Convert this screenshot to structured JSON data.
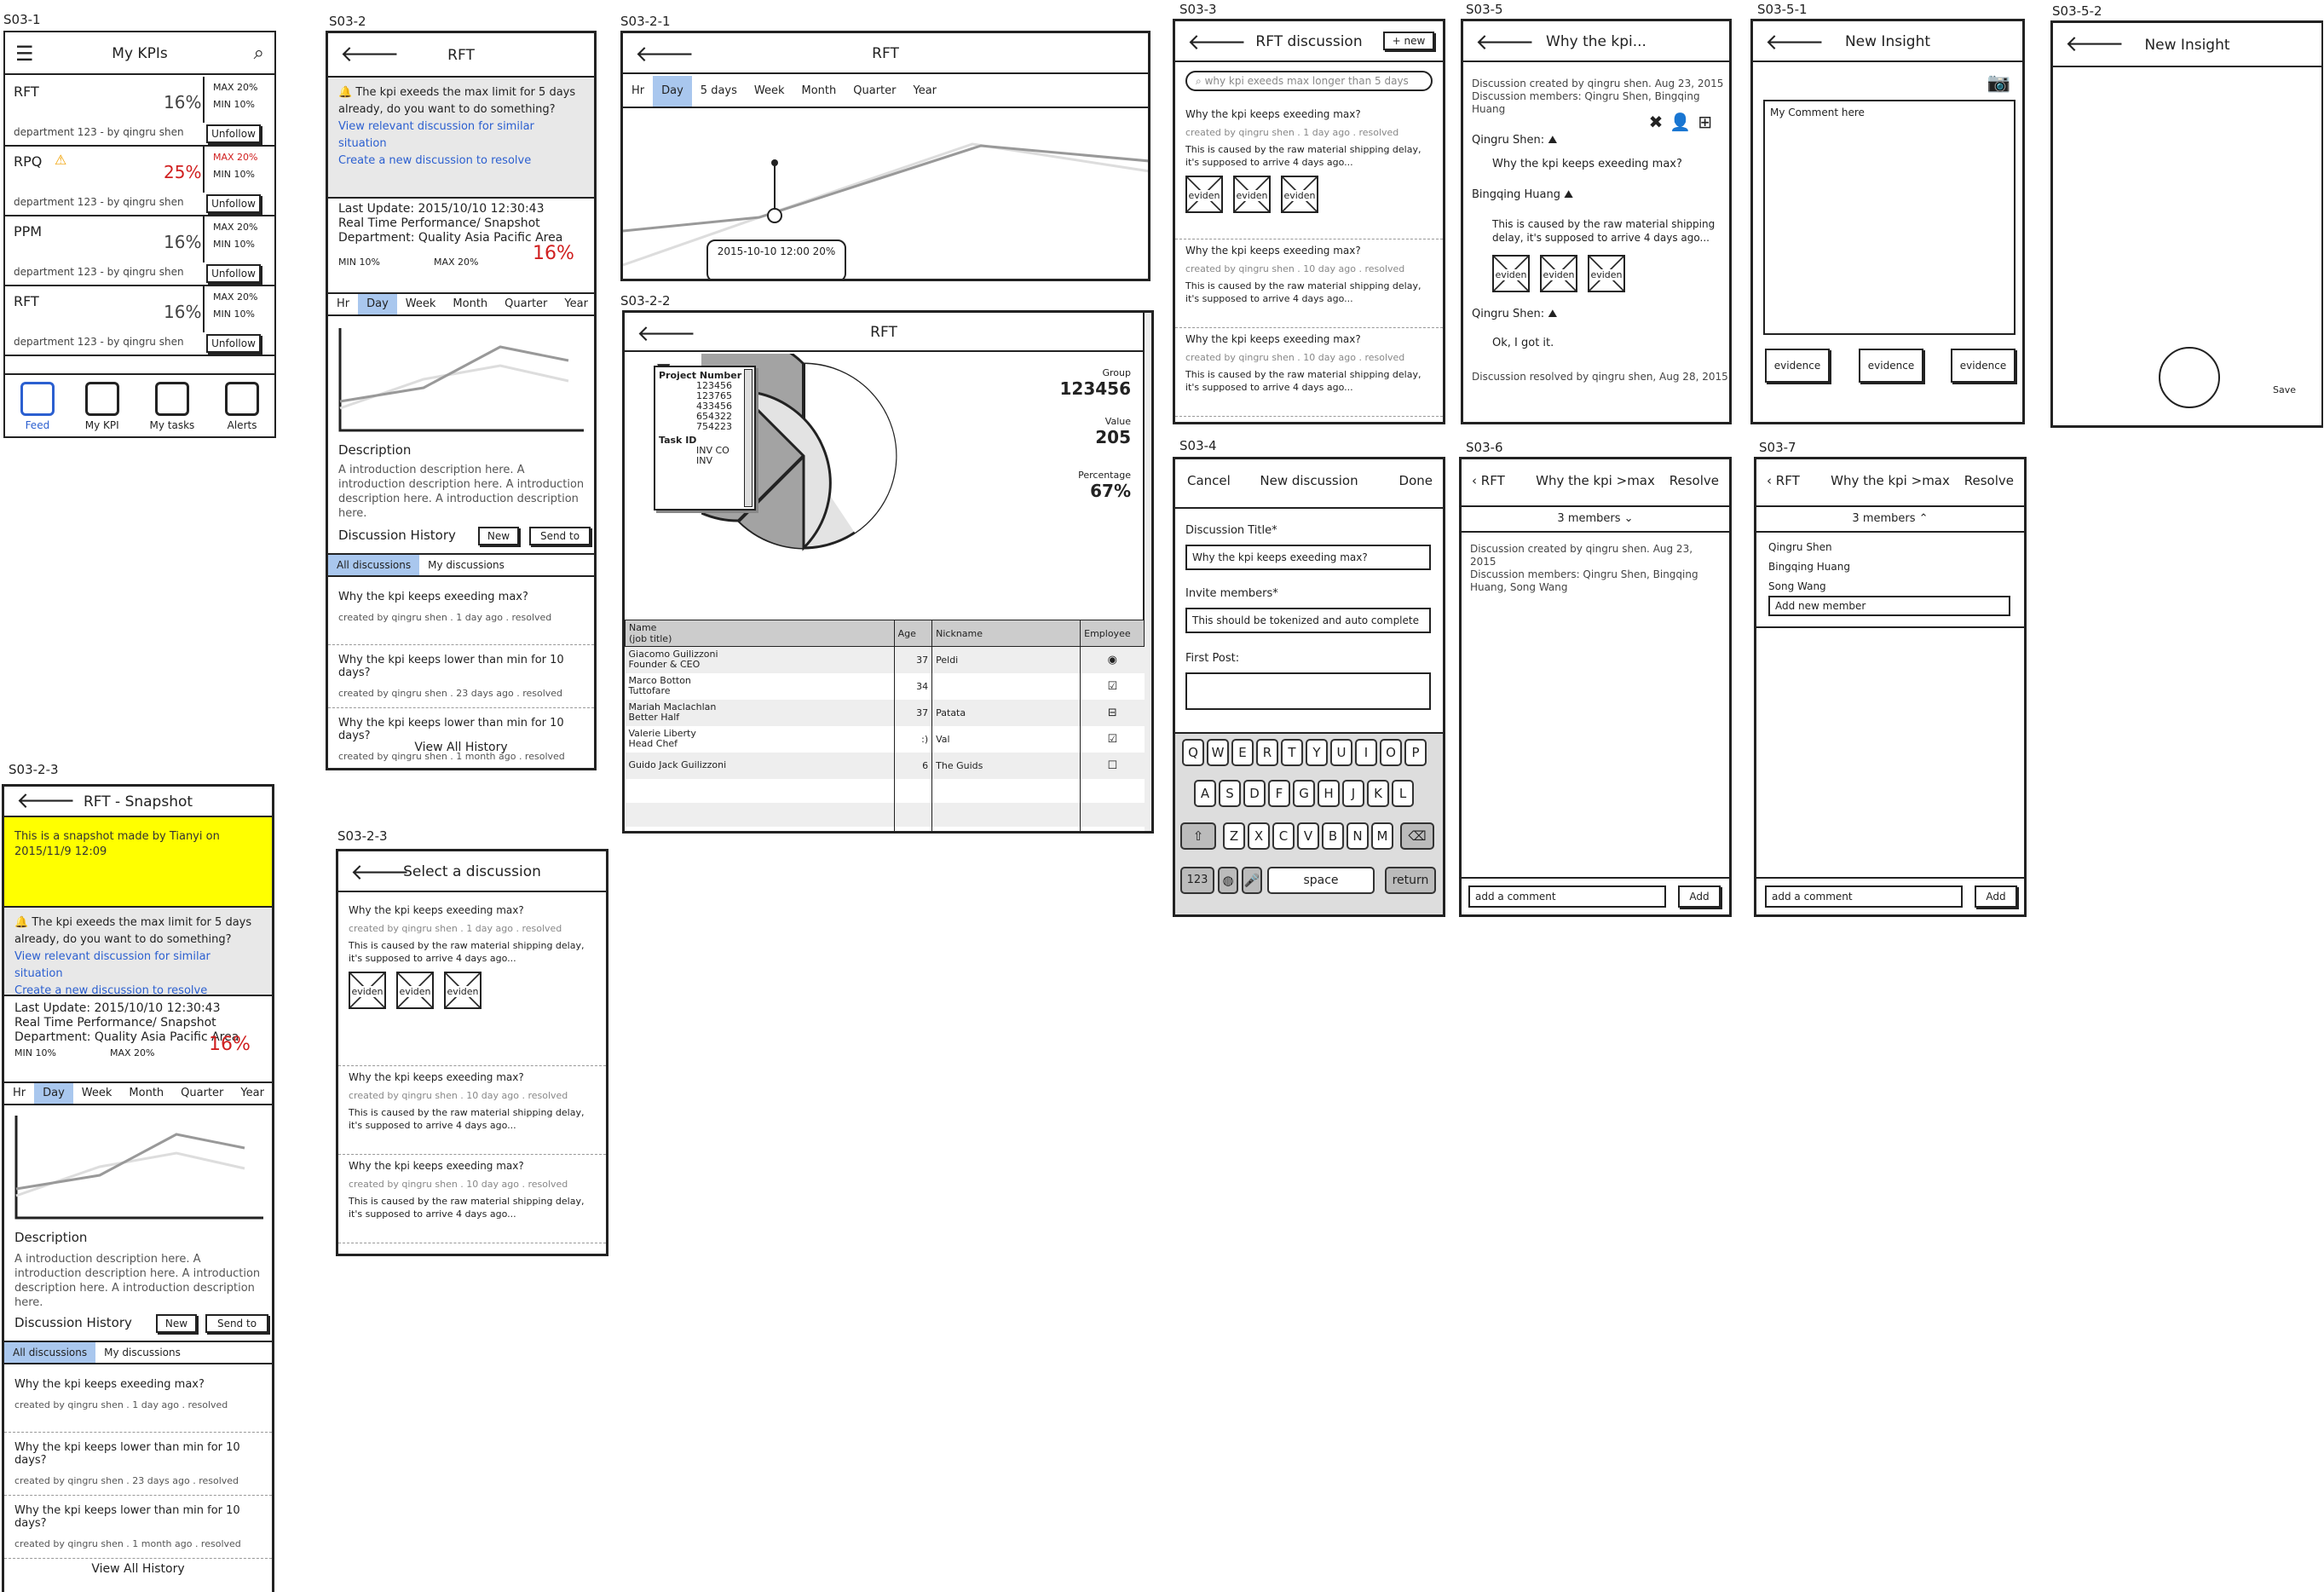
{
  "labels": {
    "s1": "S03-1",
    "s2": "S03-2",
    "s21": "S03-2-1",
    "s22": "S03-2-2",
    "s23a": "S03-2-3",
    "s23b": "S03-2-3",
    "s3": "S03-3",
    "s4": "S03-4",
    "s5": "S03-5",
    "s51": "S03-5-1",
    "s52": "S03-5-2",
    "s6": "S03-6",
    "s7": "S03-7"
  },
  "s1": {
    "title": "My KPIs",
    "kpis": [
      {
        "name": "RFT",
        "val": "16%",
        "max": "MAX 20%",
        "min": "MIN 10%",
        "dept": "department 123 - by qingru shen",
        "btn": "Unfollow",
        "alert": false
      },
      {
        "name": "RPQ",
        "val": "25%",
        "max": "MAX 20%",
        "min": "MIN 10%",
        "dept": "department 123 - by qingru shen",
        "btn": "Unfollow",
        "alert": true
      },
      {
        "name": "PPM",
        "val": "16%",
        "max": "MAX 20%",
        "min": "MIN 10%",
        "dept": "department 123 - by qingru shen",
        "btn": "Unfollow",
        "alert": false
      },
      {
        "name": "RFT",
        "val": "16%",
        "max": "MAX 20%",
        "min": "MIN 10%",
        "dept": "department 123 - by qingru shen",
        "btn": "Unfollow",
        "alert": false
      }
    ],
    "nav": [
      "Feed",
      "My KPI",
      "My tasks",
      "Alerts"
    ]
  },
  "s2": {
    "title": "RFT",
    "alert": "The kpi exeeds the max limit for 5 days already, do you want to do something?",
    "link1": "View relevant discussion for similar situation",
    "link2": "Create a new discussion to resolve",
    "update": "Last Update: 2015/10/10 12:30:43",
    "perf": "Real Time Performance/ Snapshot",
    "dept": "Department: Quality Asia Pacific Area",
    "min": "MIN 10%",
    "max": "MAX 20%",
    "val": "16%",
    "tabs": [
      "Hr",
      "Day",
      "Week",
      "Month",
      "Quarter",
      "Year"
    ],
    "desc_h": "Description",
    "desc": "A introduction description here. A introduction description here. A introduction description here. A introduction description here.",
    "hist": "Discussion History",
    "new": "New",
    "send": "Send to",
    "dtabs": [
      "All discussions",
      "My discussions"
    ],
    "items": [
      {
        "t": "Why the kpi keeps exeeding max?",
        "m": "created by qingru shen . 1 day ago . resolved"
      },
      {
        "t": "Why the kpi keeps lower than min for 10 days?",
        "m": "created by qingru shen . 23 days ago . resolved"
      },
      {
        "t": "Why the kpi keeps lower than min for 10 days?",
        "m": "created by qingru shen . 1 month ago . resolved"
      }
    ],
    "all": "View All History"
  },
  "s21": {
    "title": "RFT",
    "tabs": [
      "Hr",
      "Day",
      "5 days",
      "Week",
      "Month",
      "Quarter",
      "Year"
    ],
    "tip": "2015-10-10 12:00 20%"
  },
  "s22": {
    "title": "RFT",
    "filter": {
      "h1": "Project Number",
      "nums": [
        "123456",
        "123765",
        "433456",
        "654322",
        "754223"
      ],
      "h2": "Task ID",
      "ids": [
        "INV CO",
        "INV"
      ]
    },
    "group_l": "Group",
    "group_v": "123456",
    "value_l": "Value",
    "value_v": "205",
    "pct_l": "Percentage",
    "pct_v": "67%",
    "cols": [
      "Name\n(job title)",
      "Age",
      "Nickname",
      "Employee"
    ],
    "rows": [
      {
        "n": "Giacomo Guilizzoni\nFounder & CEO",
        "a": "37",
        "k": "Peldi",
        "e": "radio"
      },
      {
        "n": "Marco Botton\nTuttofare",
        "a": "34",
        "k": "",
        "e": "check"
      },
      {
        "n": "Mariah Maclachlan\nBetter Half",
        "a": "37",
        "k": "Patata",
        "e": "minus"
      },
      {
        "n": "Valerie Liberty\nHead Chef",
        "a": ":)",
        "k": "Val",
        "e": "check"
      },
      {
        "n": "Guido Jack Guilizzoni",
        "a": "6",
        "k": "The Guids",
        "e": "empty"
      }
    ]
  },
  "s23": {
    "title": "RFT - Snapshot",
    "note": "This is a snapshot made by Tianyi on 2015/11/9 12:09"
  },
  "s23b": {
    "title": "Select a discussion",
    "items": [
      {
        "t": "Why the kpi keeps exeeding max?",
        "m": "created by qingru shen . 1 day ago . resolved",
        "b": "This is caused by the raw material shipping delay, it's supposed to arrive 4 days ago...",
        "ev": true
      },
      {
        "t": "Why the kpi keeps exeeding max?",
        "m": "created by qingru shen . 10 day ago . resolved",
        "b": "This is caused by the raw material shipping delay, it's supposed to arrive 4 days ago...",
        "ev": false
      },
      {
        "t": "Why the kpi keeps exeeding max?",
        "m": "created by qingru shen . 10 day ago . resolved",
        "b": "This is caused by the raw material shipping delay, it's supposed to arrive 4 days ago...",
        "ev": false
      }
    ],
    "ev": "eviden"
  },
  "s3": {
    "title": "RFT discussion",
    "new": "+ new",
    "search": "why kpi exeeds max longer than 5 days"
  },
  "s4": {
    "cancel": "Cancel",
    "title": "New discussion",
    "done": "Done",
    "l1": "Discussion Title*",
    "v1": "Why the kpi keeps exeeding max?",
    "l2": "Invite members*",
    "v2": "This should be tokenized and auto complete",
    "l3": "First Post:",
    "row1": [
      "Q",
      "W",
      "E",
      "R",
      "T",
      "Y",
      "U",
      "I",
      "O",
      "P"
    ],
    "row2": [
      "A",
      "S",
      "D",
      "F",
      "G",
      "H",
      "J",
      "K",
      "L"
    ],
    "row3": [
      "Z",
      "X",
      "C",
      "V",
      "B",
      "N",
      "M"
    ],
    "k123": "123",
    "space": "space",
    "ret": "return"
  },
  "s5": {
    "title": "Why the kpi...",
    "created": "Discussion created by qingru shen. Aug 23, 2015",
    "members": "Discussion members: Qingru Shen, Bingqing Huang",
    "u1": "Qingru Shen:",
    "m1": "Why the kpi keeps exeeding max?",
    "u2": "Bingqing Huang",
    "m2": "This is caused by the raw material shipping delay, it's supposed to arrive 4 days ago...",
    "u3": "Qingru Shen:",
    "m3": "Ok, I got it.",
    "resolved": "Discussion resolved by qingru shen, Aug 28, 2015"
  },
  "s51": {
    "title": "New Insight",
    "comment": "My Comment here",
    "ev": "evidence"
  },
  "s52": {
    "title": "New Insight",
    "save": "Save"
  },
  "s6": {
    "back": "RFT",
    "title": "Why the kpi >max",
    "resolve": "Resolve",
    "members": "3 members",
    "created": "Discussion created by qingru shen. Aug 23, 2015",
    "list": "Discussion members: Qingru Shen, Bingqing Huang, Song Wang",
    "ph": "add a comment",
    "add": "Add"
  },
  "s7": {
    "back": "RFT",
    "title": "Why the kpi >max",
    "resolve": "Resolve",
    "members": "3 members",
    "names": [
      "Qingru Shen",
      "Bingqing Huang",
      "Song Wang"
    ],
    "addm": "Add new member",
    "ph": "add a comment",
    "add": "Add"
  }
}
